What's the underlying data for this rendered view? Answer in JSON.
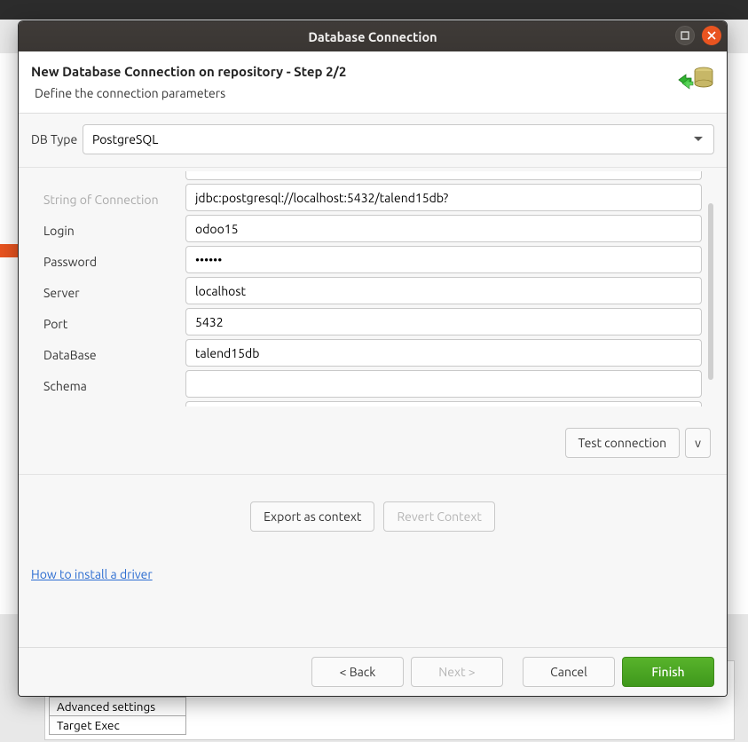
{
  "window": {
    "title": "Database Connection"
  },
  "header": {
    "title": "New Database Connection on repository - Step 2/2",
    "subtitle": "Define the connection parameters"
  },
  "dbtype": {
    "label": "DB Type",
    "value": "PostgreSQL"
  },
  "fields": {
    "string_of_connection": {
      "label": "String of Connection",
      "value": "jdbc:postgresql://localhost:5432/talend15db?"
    },
    "login": {
      "label": "Login",
      "value": "odoo15"
    },
    "password": {
      "label": "Password",
      "value": "••••••"
    },
    "server": {
      "label": "Server",
      "value": "localhost"
    },
    "port": {
      "label": "Port",
      "value": "5432"
    },
    "database": {
      "label": "DataBase",
      "value": "talend15db"
    },
    "schema": {
      "label": "Schema",
      "value": ""
    }
  },
  "buttons": {
    "test_connection": "Test connection",
    "test_dropdown": "v",
    "export_context": "Export as context",
    "revert_context": "Revert Context",
    "back": "< Back",
    "next": "Next >",
    "cancel": "Cancel",
    "finish": "Finish"
  },
  "link": {
    "install_driver": "How to install a driver"
  },
  "background_tabs": {
    "advanced": "Advanced settings",
    "target": "Target Exec"
  }
}
